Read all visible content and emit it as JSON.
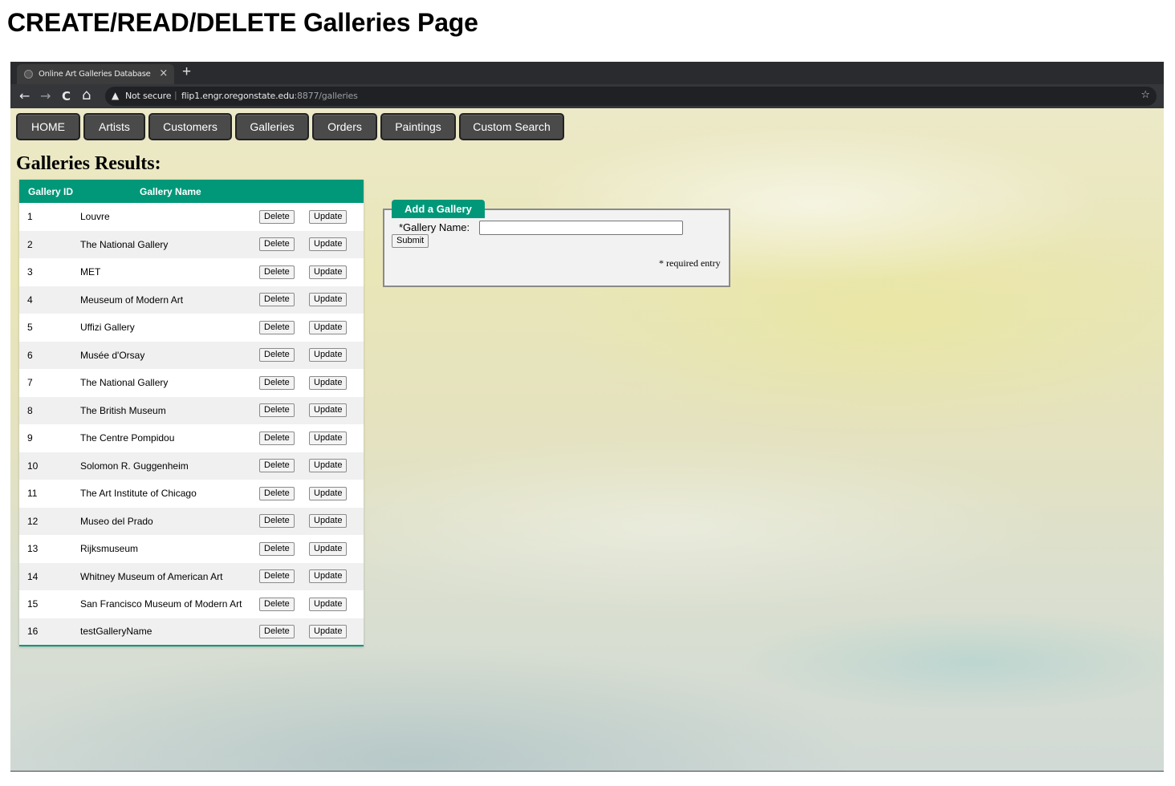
{
  "document": {
    "heading": "CREATE/READ/DELETE Galleries Page"
  },
  "browser": {
    "tab_title": "Online Art Galleries Database",
    "tab_close": "×",
    "new_tab": "+",
    "back_icon": "←",
    "forward_icon": "→",
    "reload_icon": "C",
    "home_icon": "⌂",
    "security_icon": "▲",
    "security_text": "Not secure",
    "url_host": "flip1.engr.oregonstate.edu",
    "url_path": ":8877/galleries",
    "star_icon": "☆"
  },
  "nav": {
    "items": [
      {
        "label": "HOME"
      },
      {
        "label": "Artists"
      },
      {
        "label": "Customers"
      },
      {
        "label": "Galleries"
      },
      {
        "label": "Orders"
      },
      {
        "label": "Paintings"
      },
      {
        "label": "Custom Search"
      }
    ]
  },
  "results": {
    "heading": "Galleries Results:",
    "columns": [
      "Gallery ID",
      "Gallery Name"
    ],
    "delete_label": "Delete",
    "update_label": "Update",
    "rows": [
      {
        "id": "1",
        "name": "Louvre"
      },
      {
        "id": "2",
        "name": "The National Gallery"
      },
      {
        "id": "3",
        "name": "MET"
      },
      {
        "id": "4",
        "name": "Meuseum of Modern Art"
      },
      {
        "id": "5",
        "name": "Uffizi Gallery"
      },
      {
        "id": "6",
        "name": "Musée d'Orsay"
      },
      {
        "id": "7",
        "name": "The National Gallery"
      },
      {
        "id": "8",
        "name": "The British Museum"
      },
      {
        "id": "9",
        "name": "The Centre Pompidou"
      },
      {
        "id": "10",
        "name": "Solomon R. Guggenheim"
      },
      {
        "id": "11",
        "name": "The Art Institute of Chicago"
      },
      {
        "id": "12",
        "name": "Museo del Prado"
      },
      {
        "id": "13",
        "name": "Rijksmuseum"
      },
      {
        "id": "14",
        "name": "Whitney Museum of American Art"
      },
      {
        "id": "15",
        "name": "San Francisco Museum of Modern Art"
      },
      {
        "id": "16",
        "name": "testGalleryName"
      }
    ]
  },
  "add_form": {
    "legend": "Add a Gallery",
    "field_label": "*Gallery Name:",
    "field_value": "",
    "submit_label": "Submit",
    "required_note": "* required entry"
  },
  "colors": {
    "accent": "#009879",
    "nav_button": "#4a4a4a"
  }
}
